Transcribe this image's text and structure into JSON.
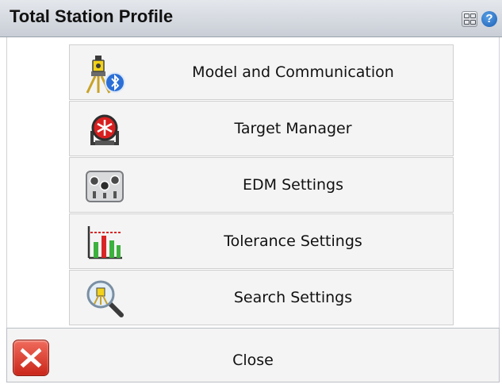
{
  "window": {
    "title": "Total Station Profile"
  },
  "title_bar_icons": [
    "grid-view-icon",
    "help-icon"
  ],
  "help_glyph": "?",
  "menu": {
    "items": [
      {
        "label": "Model and Communication",
        "icon": "total-station-bluetooth-icon"
      },
      {
        "label": "Target Manager",
        "icon": "target-prism-icon"
      },
      {
        "label": "EDM Settings",
        "icon": "edm-controls-icon"
      },
      {
        "label": "Tolerance Settings",
        "icon": "tolerance-chart-icon"
      },
      {
        "label": "Search Settings",
        "icon": "search-magnifier-icon"
      }
    ]
  },
  "footer": {
    "close_label": "Close",
    "close_icon": "close-x-icon"
  },
  "colors": {
    "title_bar": "#d3d7de",
    "close_red": "#d9352a",
    "help_blue": "#1a5fb4"
  }
}
